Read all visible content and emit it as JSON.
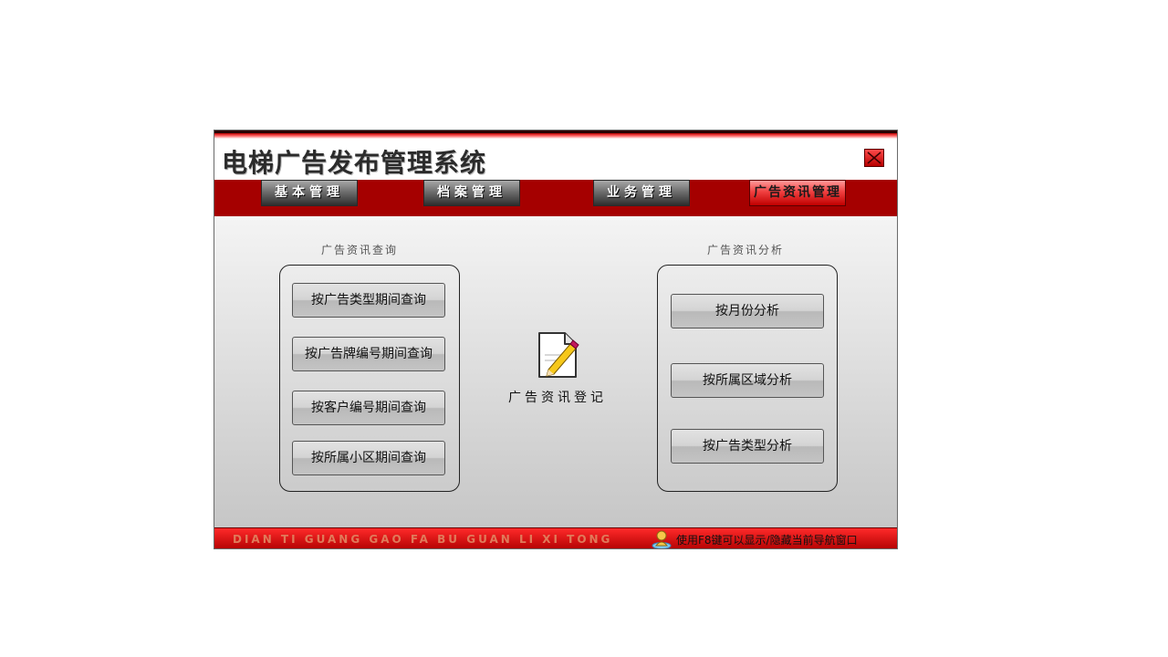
{
  "window": {
    "title": "电梯广告发布管理系统",
    "close_icon": "close-icon"
  },
  "menu": [
    {
      "label": "基本管理",
      "active": false
    },
    {
      "label": "档案管理",
      "active": false
    },
    {
      "label": "业务管理",
      "active": false
    },
    {
      "label": "广告资讯管理",
      "active": true
    }
  ],
  "left_panel": {
    "title": "广告资讯查询",
    "buttons": [
      "按广告类型期间查询",
      "按广告牌编号期间查询",
      "按客户编号期间查询",
      "按所属小区期间查询"
    ]
  },
  "center": {
    "icon": "edit-document-icon",
    "label": "广告资讯登记"
  },
  "right_panel": {
    "title": "广告资讯分析",
    "buttons": [
      "按月份分析",
      "按所属区域分析",
      "按广告类型分析"
    ]
  },
  "statusbar": {
    "pinyin": "DIAN TI GUANG GAO FA BU GUAN LI XI TONG",
    "hint": "使用F8键可以显示/隐藏当前导航窗口",
    "hint_icon": "user-icon"
  },
  "colors": {
    "menubar": "#a50000",
    "active_menu": "#f04040",
    "statusbar": "#d80000"
  }
}
